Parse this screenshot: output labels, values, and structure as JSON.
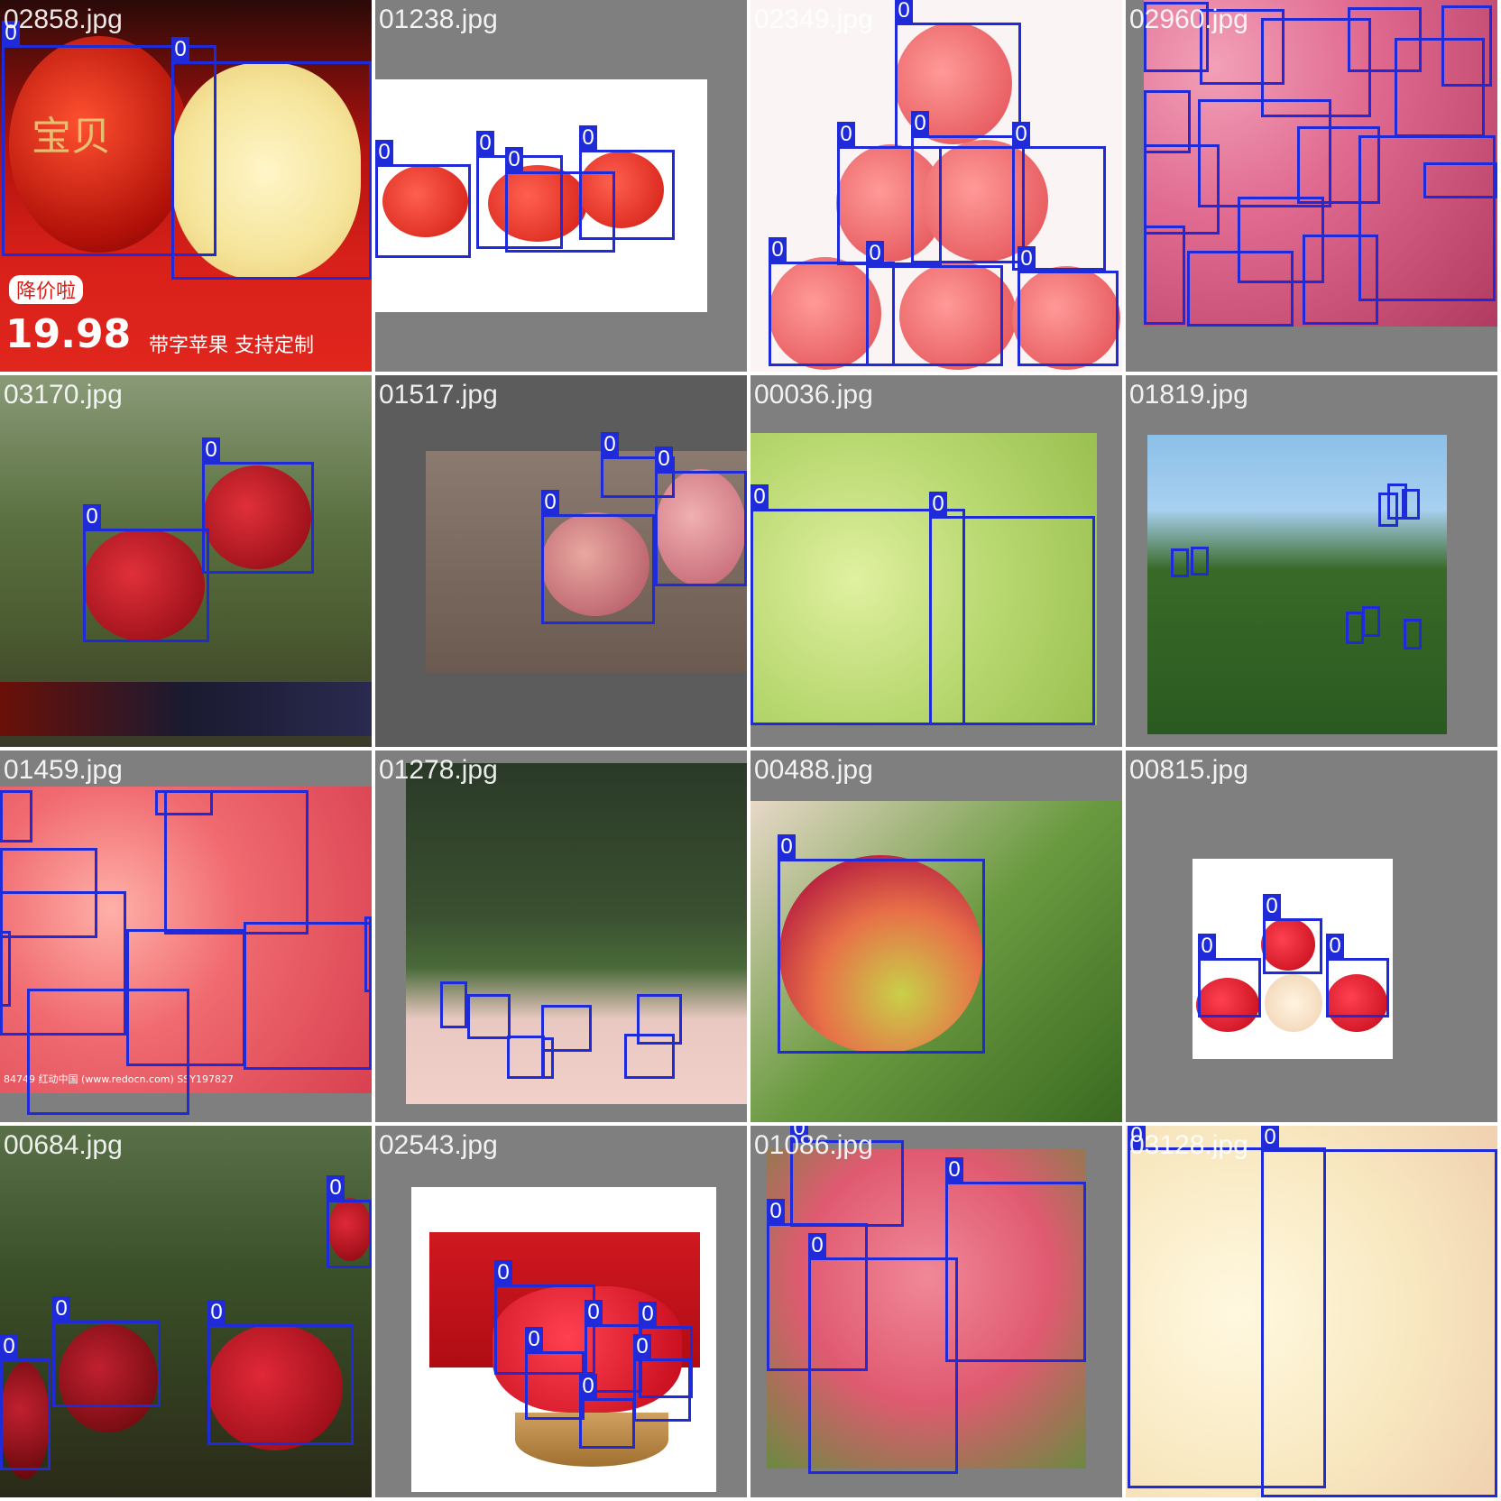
{
  "grid": {
    "tiles": [
      {
        "filename": "02858.jpg",
        "class_label": "0",
        "box_count": 2,
        "overlay_texts": [
          "宝贝",
          "降价啦",
          "19.98",
          "带字苹果 支持定制"
        ]
      },
      {
        "filename": "01238.jpg",
        "class_label": "0",
        "box_count": 4
      },
      {
        "filename": "02349.jpg",
        "class_label": "0",
        "box_count": 7
      },
      {
        "filename": "02960.jpg",
        "class_label": "0",
        "box_count": 16
      },
      {
        "filename": "03170.jpg",
        "class_label": "0",
        "box_count": 2
      },
      {
        "filename": "01517.jpg",
        "class_label": "0",
        "box_count": 3
      },
      {
        "filename": "00036.jpg",
        "class_label": "0",
        "box_count": 2
      },
      {
        "filename": "01819.jpg",
        "class_label": "0",
        "box_count": 9
      },
      {
        "filename": "01459.jpg",
        "class_label": "0",
        "box_count": 10,
        "overlay_texts": [
          "84749  红动中国 (www.redocn.com)  SSY197827"
        ]
      },
      {
        "filename": "01278.jpg",
        "class_label": "0",
        "box_count": 9
      },
      {
        "filename": "00488.jpg",
        "class_label": "0",
        "box_count": 1
      },
      {
        "filename": "00815.jpg",
        "class_label": "0",
        "box_count": 3
      },
      {
        "filename": "00684.jpg",
        "class_label": "0",
        "box_count": 4
      },
      {
        "filename": "02543.jpg",
        "class_label": "0",
        "box_count": 7
      },
      {
        "filename": "01086.jpg",
        "class_label": "0",
        "box_count": 4
      },
      {
        "filename": "03128.jpg",
        "class_label": "0",
        "box_count": 2
      }
    ]
  },
  "colors": {
    "box": "#1f2bd8",
    "tile_bg": "#7f7f7f",
    "label_text": "#ffffff"
  }
}
